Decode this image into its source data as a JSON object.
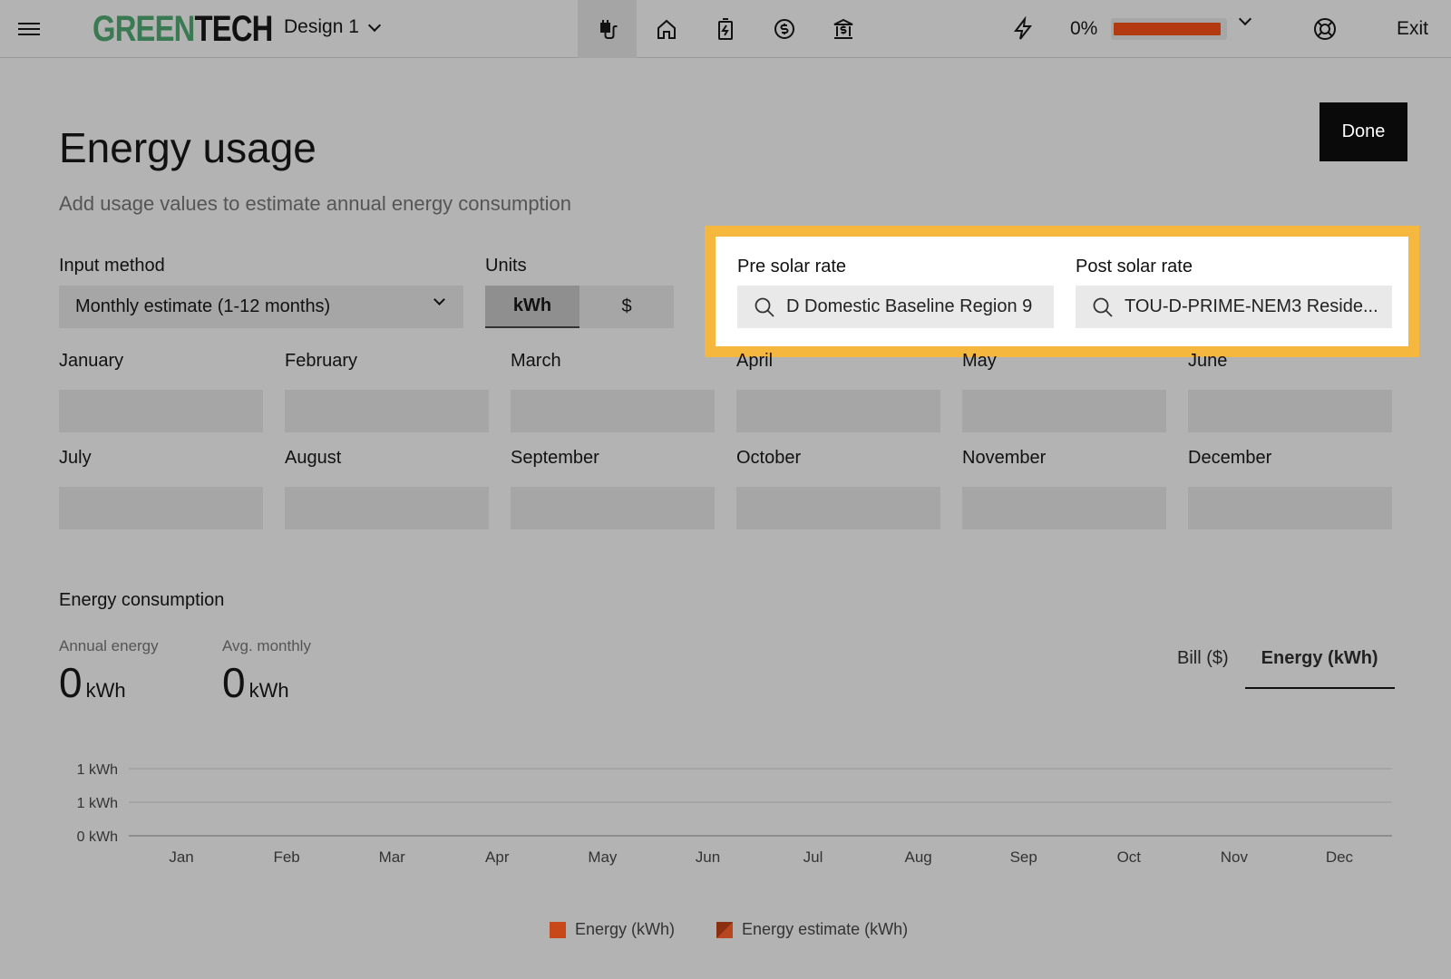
{
  "header": {
    "brand_part1": "GREEN",
    "brand_part2": "TECH",
    "design_label": "Design 1",
    "progress_label": "0%",
    "progress_value": 0.0,
    "exit_label": "Exit",
    "nav_icons": [
      "plug-icon",
      "home-icon",
      "battery-icon",
      "dollar-icon",
      "incentive-icon"
    ],
    "accent_color": "#b33a10",
    "brand_color": "#3a7a53"
  },
  "page": {
    "title": "Energy usage",
    "subtitle": "Add usage values to estimate annual energy consumption",
    "done_label": "Done"
  },
  "form": {
    "input_method_label": "Input method",
    "input_method_value": "Monthly estimate (1-12 months)",
    "units_label": "Units",
    "unit_kwh": "kWh",
    "unit_dollar": "$",
    "pre_solar_label": "Pre solar rate",
    "pre_solar_value": "D Domestic Baseline Region 9",
    "post_solar_label": "Post solar rate",
    "post_solar_value": "TOU-D-PRIME-NEM3 Reside...",
    "highlight_color": "#f5b73d"
  },
  "months": [
    "January",
    "February",
    "March",
    "April",
    "May",
    "June",
    "July",
    "August",
    "September",
    "October",
    "November",
    "December"
  ],
  "consumption": {
    "title": "Energy consumption",
    "annual_label": "Annual energy",
    "annual_value": "0",
    "annual_unit": "kWh",
    "monthly_label": "Avg. monthly",
    "monthly_value": "0",
    "monthly_unit": "kWh",
    "tab_bill": "Bill ($)",
    "tab_energy": "Energy (kWh)"
  },
  "chart_data": {
    "type": "bar",
    "categories": [
      "Jan",
      "Feb",
      "Mar",
      "Apr",
      "May",
      "Jun",
      "Jul",
      "Aug",
      "Sep",
      "Oct",
      "Nov",
      "Dec"
    ],
    "y_tick_labels": [
      "1 kWh",
      "1 kWh",
      "0 kWh"
    ],
    "series": [
      {
        "name": "Energy (kWh)",
        "values": [
          0,
          0,
          0,
          0,
          0,
          0,
          0,
          0,
          0,
          0,
          0,
          0
        ],
        "color": "#c9481a"
      },
      {
        "name": "Energy estimate (kWh)",
        "values": [
          0,
          0,
          0,
          0,
          0,
          0,
          0,
          0,
          0,
          0,
          0,
          0
        ],
        "color": "#b8461e"
      }
    ],
    "grid": true,
    "legend": "bottom-center"
  }
}
